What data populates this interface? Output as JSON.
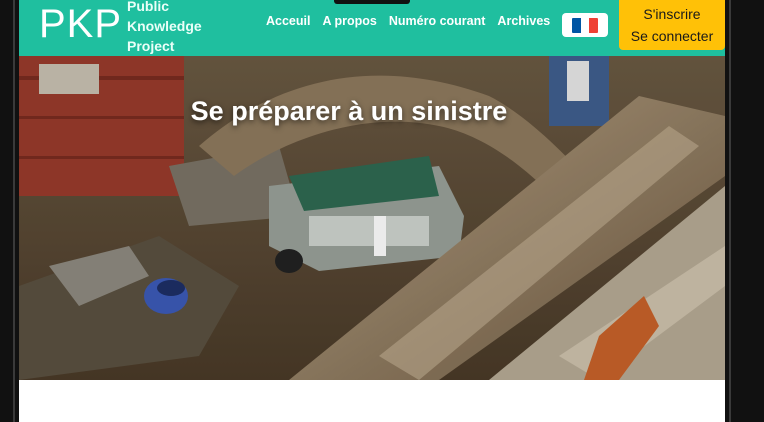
{
  "header": {
    "logo": "PKP",
    "logo_sub": [
      "Public",
      "Knowledge",
      "Project"
    ],
    "nav": [
      "Acceuil",
      "A propos",
      "Numéro courant",
      "Archives"
    ],
    "language": "fr",
    "auth": {
      "register": "S'inscrire",
      "login": "Se connecter"
    },
    "colors": {
      "header_bg": "#1fbf9f",
      "auth_bg": "#ffc107"
    }
  },
  "hero": {
    "title": "Se préparer à un sinistre"
  }
}
